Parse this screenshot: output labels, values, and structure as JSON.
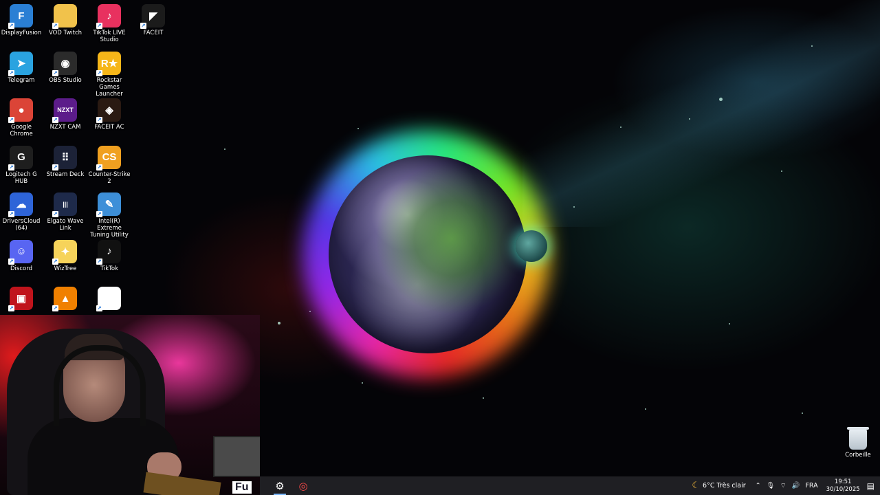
{
  "desktop": {
    "icons": [
      {
        "label": "DisplayFusion",
        "icon": "displayfusion-icon",
        "glyph": "F",
        "bg": "#2a7fd4",
        "col": 0,
        "row": 0
      },
      {
        "label": "VOD Twitch",
        "icon": "folder-icon",
        "glyph": "",
        "bg": "#f1c24b",
        "col": 1,
        "row": 0
      },
      {
        "label": "TikTok LIVE Studio",
        "icon": "tiktok-live-studio-icon",
        "glyph": "♪",
        "bg": "#e8315f",
        "col": 2,
        "row": 0
      },
      {
        "label": "FACEIT",
        "icon": "faceit-icon",
        "glyph": "◤",
        "bg": "#1b1b1b",
        "col": 3,
        "row": 0
      },
      {
        "label": "Telegram",
        "icon": "telegram-icon",
        "glyph": "➤",
        "bg": "#2aa3e0",
        "col": 0,
        "row": 1
      },
      {
        "label": "OBS Studio",
        "icon": "obs-studio-icon",
        "glyph": "◉",
        "bg": "#2b2b2b",
        "col": 1,
        "row": 1
      },
      {
        "label": "Rockstar Games Launcher",
        "icon": "rockstar-games-icon",
        "glyph": "R★",
        "bg": "#f6b619",
        "col": 2,
        "row": 1
      },
      {
        "label": "Google Chrome",
        "icon": "google-chrome-icon",
        "glyph": "●",
        "bg": "#db4437",
        "col": 0,
        "row": 2
      },
      {
        "label": "NZXT CAM",
        "icon": "nzxt-cam-icon",
        "glyph": "NZXT",
        "bg": "#5c1c8a",
        "col": 1,
        "row": 2
      },
      {
        "label": "FACEIT AC",
        "icon": "faceit-ac-icon",
        "glyph": "◈",
        "bg": "#2a1a12",
        "col": 2,
        "row": 2
      },
      {
        "label": "Logitech G HUB",
        "icon": "logitech-g-hub-icon",
        "glyph": "G",
        "bg": "#1e1e1e",
        "col": 0,
        "row": 3
      },
      {
        "label": "Stream Deck",
        "icon": "stream-deck-icon",
        "glyph": "⠿",
        "bg": "#1c2237",
        "col": 1,
        "row": 3
      },
      {
        "label": "Counter-Strike 2",
        "icon": "counter-strike-2-icon",
        "glyph": "CS",
        "bg": "#f0a020",
        "col": 2,
        "row": 3
      },
      {
        "label": "DriversCloud (64)",
        "icon": "driverscloud-icon",
        "glyph": "☁",
        "bg": "#2e64d8",
        "col": 0,
        "row": 4
      },
      {
        "label": "Elgato Wave Link",
        "icon": "elgato-wave-link-icon",
        "glyph": "|||",
        "bg": "#1e2a4a",
        "col": 1,
        "row": 4
      },
      {
        "label": "Intel(R) Extreme Tuning Utility",
        "icon": "intel-xtu-icon",
        "glyph": "✎",
        "bg": "#3d8fd8",
        "col": 2,
        "row": 4
      },
      {
        "label": "Discord",
        "icon": "discord-icon",
        "glyph": "☺",
        "bg": "#5865f2",
        "col": 0,
        "row": 5
      },
      {
        "label": "WizTree",
        "icon": "wiztree-icon",
        "glyph": "✦",
        "bg": "#f6d35a",
        "col": 1,
        "row": 5
      },
      {
        "label": "TikTok",
        "icon": "tiktok-icon",
        "glyph": "♪",
        "bg": "#111111",
        "col": 2,
        "row": 5
      },
      {
        "label": "",
        "icon": "red-app-icon",
        "glyph": "▣",
        "bg": "#c0141c",
        "col": 0,
        "row": 6
      },
      {
        "label": "",
        "icon": "vlc-icon",
        "glyph": "▲",
        "bg": "#f08000",
        "col": 1,
        "row": 6
      },
      {
        "label": "",
        "icon": "capcut-icon",
        "glyph": "✕",
        "bg": "#ffffff",
        "col": 2,
        "row": 6
      }
    ],
    "recycle_bin_label": "Corbeille"
  },
  "webcam": {
    "overlay_text": "Fu"
  },
  "taskbar": {
    "apps": [
      {
        "icon": "settings-gear-icon",
        "glyph": "⚙",
        "active": true
      },
      {
        "icon": "recording-app-icon",
        "glyph": "◎",
        "active": false
      }
    ],
    "tray": {
      "weather": "6°C  Très clair",
      "language": "FRA",
      "time": "19:51",
      "date": "30/10/2025"
    }
  }
}
